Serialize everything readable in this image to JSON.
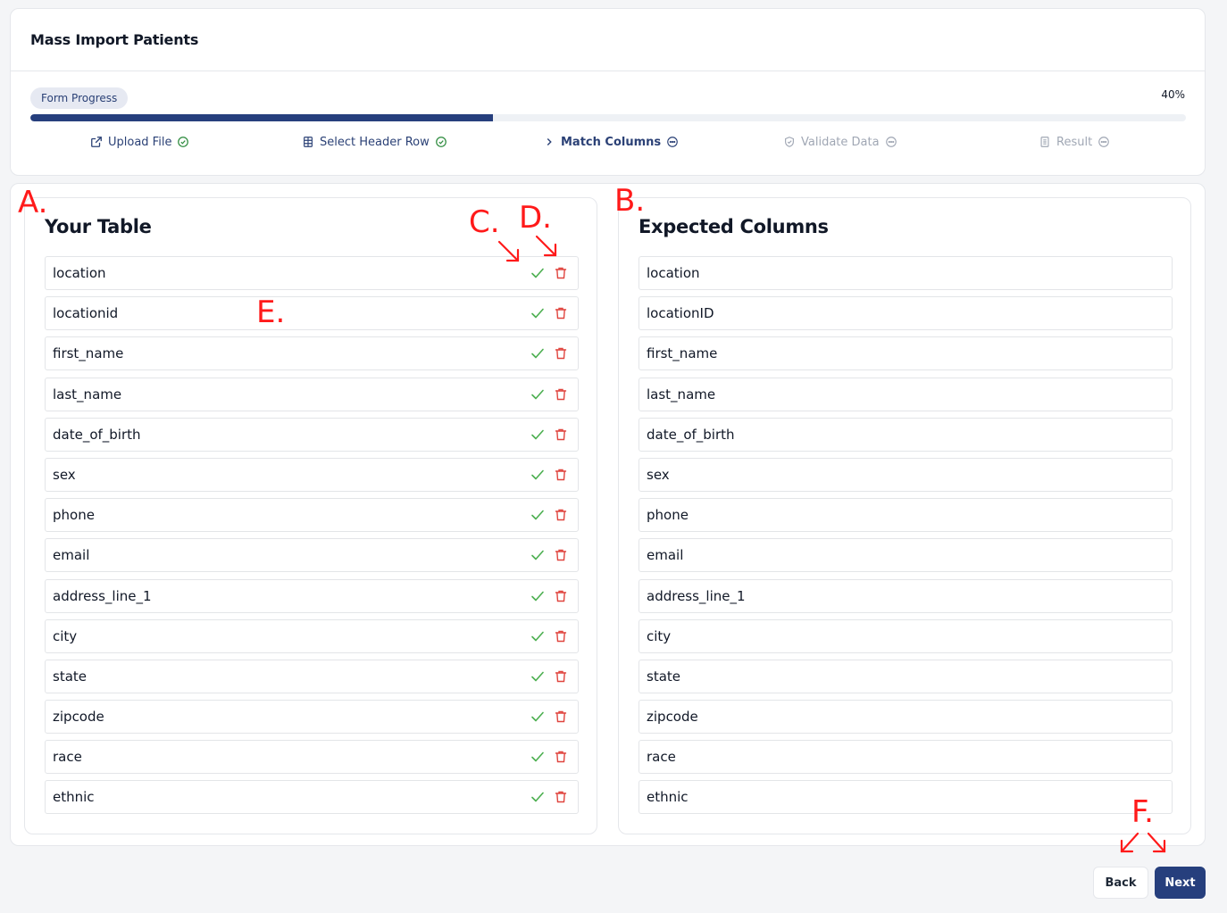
{
  "page": {
    "title": "Mass Import Patients"
  },
  "progress": {
    "badge_label": "Form Progress",
    "percent_label": "40%",
    "fraction": 0.4
  },
  "steps": [
    {
      "label": "Upload File",
      "icon": "external-link-icon",
      "status": "done"
    },
    {
      "label": "Select Header Row",
      "icon": "table-icon",
      "status": "done"
    },
    {
      "label": "Match Columns",
      "icon": "chevron-right-icon",
      "status": "current"
    },
    {
      "label": "Validate Data",
      "icon": "shield-icon",
      "status": "pending"
    },
    {
      "label": "Result",
      "icon": "document-icon",
      "status": "pending"
    }
  ],
  "your_table": {
    "title": "Your Table",
    "rows": [
      "location",
      "locationid",
      "first_name",
      "last_name",
      "date_of_birth",
      "sex",
      "phone",
      "email",
      "address_line_1",
      "city",
      "state",
      "zipcode",
      "race",
      "ethnic"
    ]
  },
  "expected_columns": {
    "title": "Expected Columns",
    "rows": [
      "location",
      "locationID",
      "first_name",
      "last_name",
      "date_of_birth",
      "sex",
      "phone",
      "email",
      "address_line_1",
      "city",
      "state",
      "zipcode",
      "race",
      "ethnic"
    ]
  },
  "annotations": {
    "a": "A.",
    "b": "B.",
    "c": "C.",
    "d": "D.",
    "e": "E.",
    "f": "F."
  },
  "footer": {
    "back_label": "Back",
    "next_label": "Next"
  },
  "colors": {
    "primary": "#263f7d",
    "check_green": "#4caf50",
    "trash_red": "#e0443e",
    "annotation_red": "#ff1a1a"
  }
}
